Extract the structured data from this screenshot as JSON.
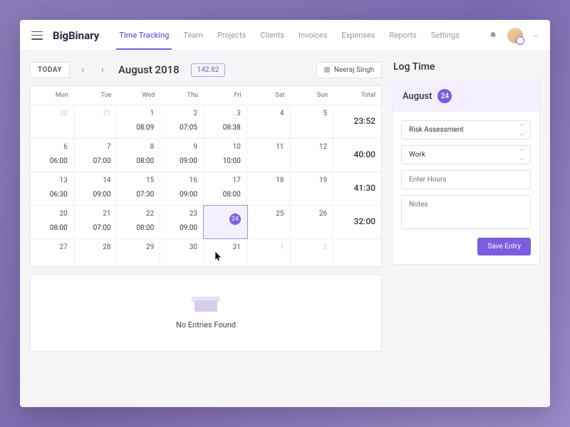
{
  "brand": "BigBinary",
  "nav": [
    "Time Tracking",
    "Team",
    "Projects",
    "Clients",
    "Invoices",
    "Expenses",
    "Reports",
    "Settings"
  ],
  "activeNav": 0,
  "today_label": "TODAY",
  "month_title": "August 2018",
  "total_hours": "142.82",
  "user_filter": "Neeraj Singh",
  "day_headers": [
    "Mon",
    "Tue",
    "Wed",
    "Thu",
    "Fri",
    "Sat",
    "Sun",
    "Total"
  ],
  "weeks": [
    [
      {
        "d": "30",
        "t": "",
        "faded": true
      },
      {
        "d": "31",
        "t": "",
        "faded": true
      },
      {
        "d": "1",
        "t": "08:09"
      },
      {
        "d": "2",
        "t": "07:05"
      },
      {
        "d": "3",
        "t": "08:38"
      },
      {
        "d": "4",
        "t": ""
      },
      {
        "d": "5",
        "t": ""
      },
      {
        "total": "23:52"
      }
    ],
    [
      {
        "d": "6",
        "t": "06:00"
      },
      {
        "d": "7",
        "t": "07:00"
      },
      {
        "d": "8",
        "t": "08:00"
      },
      {
        "d": "9",
        "t": "09:00"
      },
      {
        "d": "10",
        "t": "10:00"
      },
      {
        "d": "11",
        "t": ""
      },
      {
        "d": "12",
        "t": ""
      },
      {
        "total": "40:00"
      }
    ],
    [
      {
        "d": "13",
        "t": "06:30"
      },
      {
        "d": "14",
        "t": "09:00"
      },
      {
        "d": "15",
        "t": "07:30"
      },
      {
        "d": "16",
        "t": "09:00"
      },
      {
        "d": "17",
        "t": "08:00"
      },
      {
        "d": "18",
        "t": ""
      },
      {
        "d": "19",
        "t": ""
      },
      {
        "total": "41:30"
      }
    ],
    [
      {
        "d": "20",
        "t": "08:00"
      },
      {
        "d": "21",
        "t": "07:00"
      },
      {
        "d": "22",
        "t": "08:00"
      },
      {
        "d": "23",
        "t": "09:00"
      },
      {
        "d": "24",
        "t": "",
        "selected": true
      },
      {
        "d": "25",
        "t": ""
      },
      {
        "d": "26",
        "t": ""
      },
      {
        "total": "32:00"
      }
    ],
    [
      {
        "d": "27",
        "t": ""
      },
      {
        "d": "28",
        "t": ""
      },
      {
        "d": "29",
        "t": ""
      },
      {
        "d": "30",
        "t": ""
      },
      {
        "d": "31",
        "t": ""
      },
      {
        "d": "1",
        "t": "",
        "faded": true
      },
      {
        "d": "2",
        "t": "",
        "faded": true
      },
      {
        "total": ""
      }
    ]
  ],
  "empty_text": "No Entries Found",
  "log": {
    "heading": "Log Time",
    "month": "August",
    "day": "24",
    "project": "Risk Assessment",
    "task": "Work",
    "hours_placeholder": "Enter Hours",
    "notes_placeholder": "Notes",
    "save_label": "Save Entry"
  }
}
